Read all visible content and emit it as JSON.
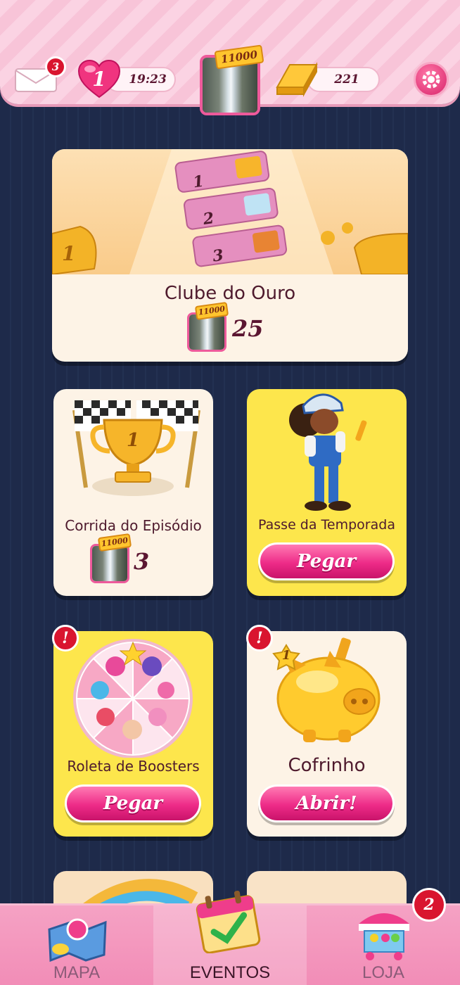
{
  "topbar": {
    "mail_badge": "3",
    "lives": "1",
    "life_timer": "19:23",
    "avatar_level": "11000",
    "gold_bars": "221"
  },
  "gold_club": {
    "title": "Clube do Ouro",
    "level_ribbon": "11000",
    "score": "25",
    "ranks": [
      "1",
      "2",
      "3"
    ],
    "trophy_number": "1"
  },
  "episode_race": {
    "title": "Corrida do Episódio",
    "level_ribbon": "11000",
    "score": "3",
    "trophy_number": "1"
  },
  "season_pass": {
    "title": "Passe da Temporada",
    "button": "Pegar"
  },
  "booster_wheel": {
    "title": "Roleta de Boosters",
    "button": "Pegar",
    "alert": "!"
  },
  "piggy_bank": {
    "title": "Cofrinho",
    "button": "Abrir!",
    "alert": "!",
    "level": "1"
  },
  "nav": {
    "map": "MAPA",
    "events": "EVENTOS",
    "shop": "LOJA",
    "shop_badge": "2"
  }
}
